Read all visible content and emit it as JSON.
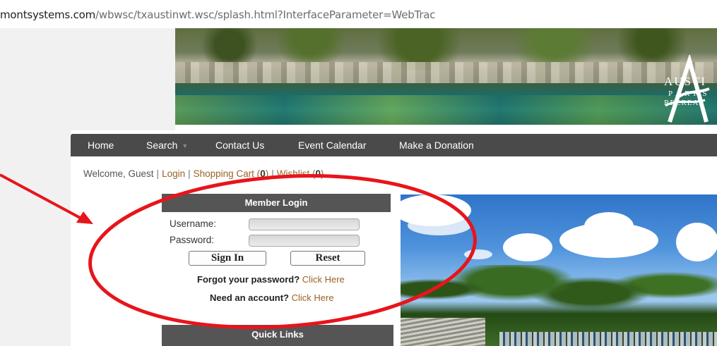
{
  "browser": {
    "url_host": "montsystems.com",
    "url_path": "/wbwsc/txaustinwt.wsc/splash.html?InterfaceParameter=WebTrac"
  },
  "banner": {
    "logo": {
      "line1": "AUSTI",
      "line2": "PARKS",
      "line3": "RECREAT"
    }
  },
  "nav": {
    "items": [
      {
        "label": "Home"
      },
      {
        "label": "Search"
      },
      {
        "label": "Contact Us"
      },
      {
        "label": "Event Calendar"
      },
      {
        "label": "Make a Donation"
      }
    ]
  },
  "welcome": {
    "greeting": "Welcome, Guest",
    "login": "Login",
    "cart_label": "Shopping Cart (",
    "cart_count": "0",
    "wishlist_label": "Wishlist (",
    "wishlist_count": "0",
    "close_paren": ")"
  },
  "login": {
    "header": "Member Login",
    "username_label": "Username:",
    "password_label": "Password:",
    "username_value": "",
    "password_value": "",
    "sign_in": "Sign In",
    "reset": "Reset",
    "forgot_text": "Forgot your password?",
    "forgot_link": "Click Here",
    "need_text": "Need an account?",
    "need_link": "Click Here"
  },
  "quick_links": {
    "header": "Quick Links"
  },
  "colors": {
    "nav_bg": "#4a4a4a",
    "link": "#9a6226",
    "annotation": "#e8141b"
  }
}
